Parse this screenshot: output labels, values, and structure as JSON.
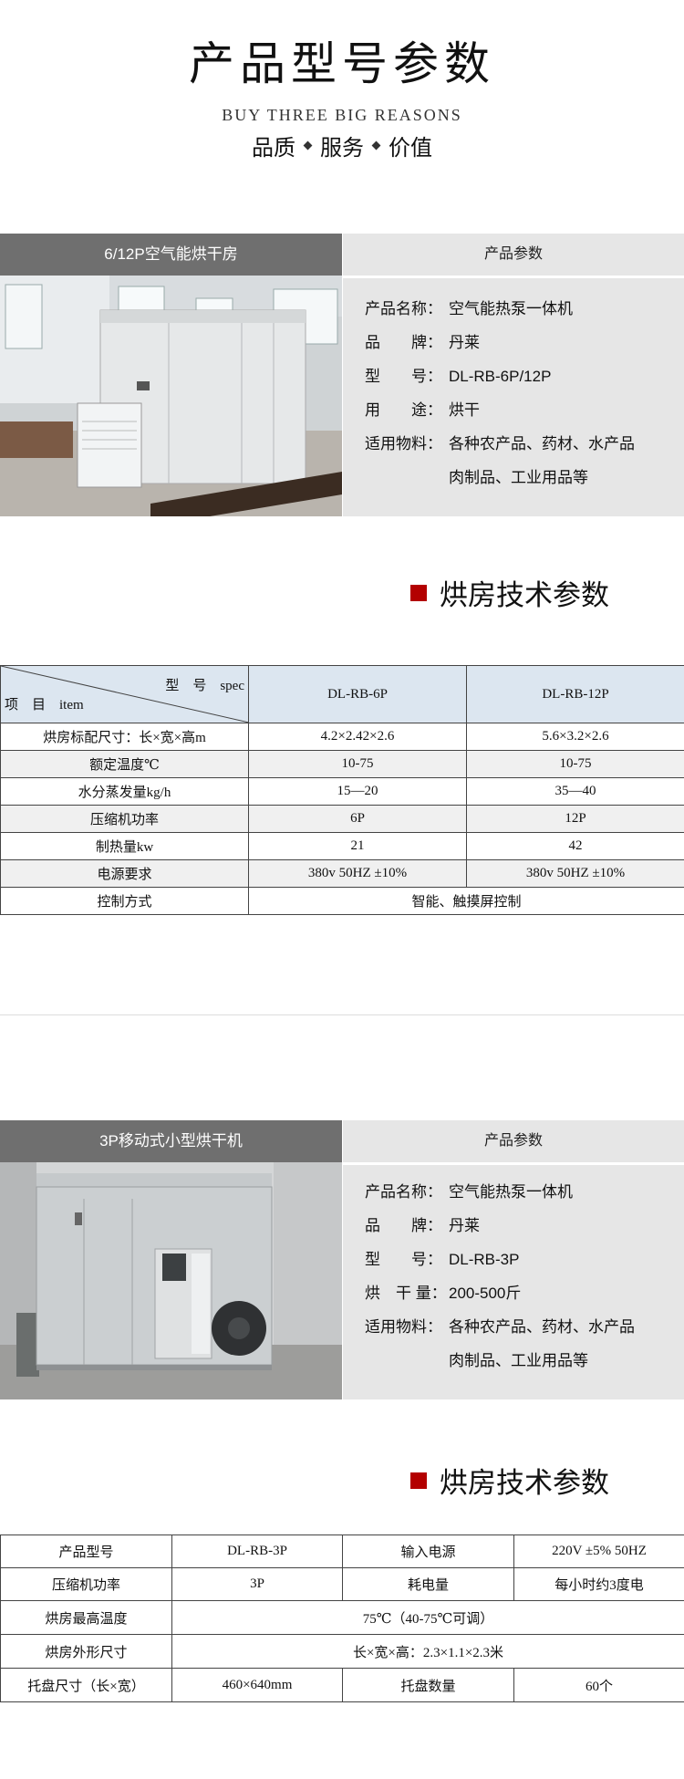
{
  "header": {
    "title": "产品型号参数",
    "subtitle": "BUY THREE BIG REASONS",
    "tags": [
      "品质",
      "服务",
      "价值"
    ]
  },
  "product1": {
    "name": "6/12P空气能烘干房",
    "params_title": "产品参数",
    "params": [
      {
        "label": "产品名称：",
        "value": "空气能热泵一体机"
      },
      {
        "label": "品　　牌：",
        "value": "丹莱"
      },
      {
        "label": "型　　号：",
        "value": "DL-RB-6P/12P"
      },
      {
        "label": "用　　途：",
        "value": "烘干"
      },
      {
        "label": "适用物料：",
        "value": "各种农产品、药材、水产品"
      },
      {
        "label": "",
        "value": "肉制品、工业用品等"
      }
    ]
  },
  "section1": {
    "title": "烘房技术参数"
  },
  "table1": {
    "corner_top": "型　号　spec",
    "corner_bottom": "项　目　item",
    "models": [
      "DL-RB-6P",
      "DL-RB-12P"
    ],
    "rows": [
      {
        "item": "烘房标配尺寸：长×宽×高m",
        "v1": "4.2×2.42×2.6",
        "v2": "5.6×3.2×2.6"
      },
      {
        "item": "额定温度℃",
        "v1": "10-75",
        "v2": "10-75"
      },
      {
        "item": "水分蒸发量kg/h",
        "v1": "15—20",
        "v2": "35—40"
      },
      {
        "item": "压缩机功率",
        "v1": "6P",
        "v2": "12P"
      },
      {
        "item": "制热量kw",
        "v1": "21",
        "v2": "42"
      },
      {
        "item": "电源要求",
        "v1": "380v 50HZ ±10%",
        "v2": "380v 50HZ ±10%"
      }
    ],
    "last_row": {
      "item": "控制方式",
      "value": "智能、触摸屏控制"
    }
  },
  "product2": {
    "name": "3P移动式小型烘干机",
    "params_title": "产品参数",
    "params": [
      {
        "label": "产品名称：",
        "value": "空气能热泵一体机"
      },
      {
        "label": "品　　牌：",
        "value": "丹莱"
      },
      {
        "label": "型　　号：",
        "value": "DL-RB-3P"
      },
      {
        "label": "烘　干 量：",
        "value": "200-500斤"
      },
      {
        "label": "适用物料：",
        "value": "各种农产品、药材、水产品"
      },
      {
        "label": "",
        "value": "肉制品、工业用品等"
      }
    ]
  },
  "section2": {
    "title": "烘房技术参数"
  },
  "table2": {
    "r1": {
      "k1": "产品型号",
      "v1": "DL-RB-3P",
      "k2": "输入电源",
      "v2": "220V ±5% 50HZ"
    },
    "r2": {
      "k1": "压缩机功率",
      "v1": "3P",
      "k2": "耗电量",
      "v2": "每小时约3度电"
    },
    "r3": {
      "k1": "烘房最高温度",
      "v1": "75℃（40-75℃可调）"
    },
    "r4": {
      "k1": "烘房外形尺寸",
      "v1": "长×宽×高：2.3×1.1×2.3米"
    },
    "r5": {
      "k1": "托盘尺寸（长×宽）",
      "v1": "460×640mm",
      "k2": "托盘数量",
      "v2": "60个"
    }
  }
}
